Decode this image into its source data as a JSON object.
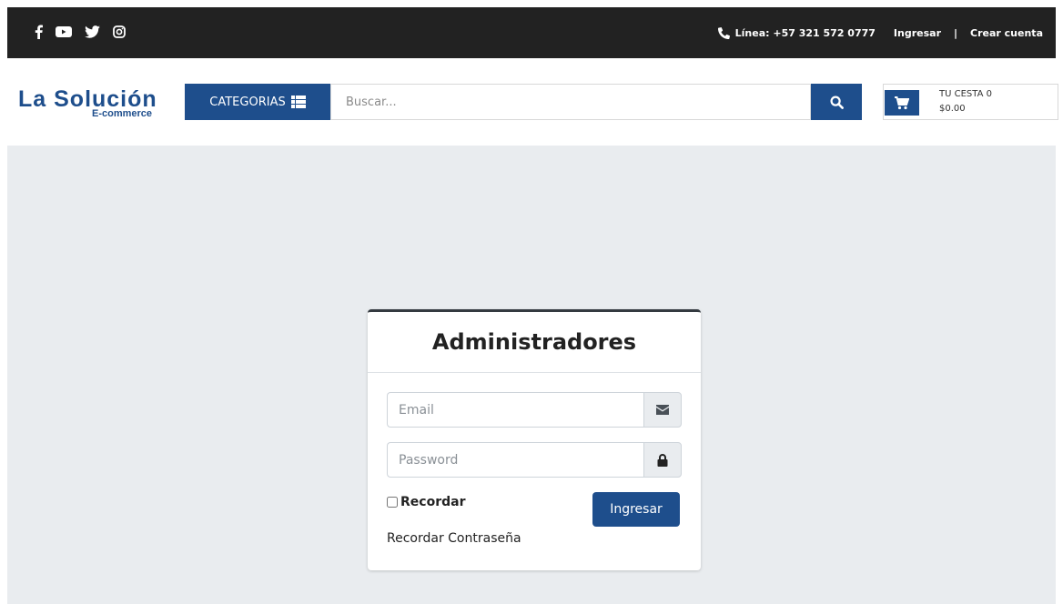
{
  "topbar": {
    "social": [
      {
        "icon": "facebook-icon"
      },
      {
        "icon": "youtube-icon"
      },
      {
        "icon": "twitter-icon"
      },
      {
        "icon": "instagram-icon"
      }
    ],
    "phone": "Línea: +57 321 572 0777",
    "login_link": "Ingresar",
    "separator": "|",
    "register_link": "Crear cuenta"
  },
  "header": {
    "logo_main": "La Solución",
    "logo_sub": "E-commerce",
    "categories_label": "CATEGORIAS",
    "search_placeholder": "Buscar...",
    "cart_label": "TU CESTA 0",
    "cart_total": "$0.00"
  },
  "login": {
    "title": "Administradores",
    "email_placeholder": "Email",
    "password_placeholder": "Password",
    "remember_label": "Recordar",
    "submit_label": "Ingresar",
    "forgot_link": "Recordar Contraseña"
  },
  "colors": {
    "brand": "#1e4e8c",
    "topbar": "#222222",
    "content_bg": "#e9ecef"
  }
}
